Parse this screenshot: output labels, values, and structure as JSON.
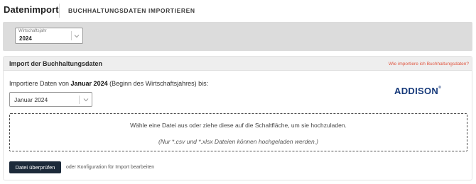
{
  "header": {
    "app_title": "Datenimport",
    "page_title": "BUCHHALTUNGSDATEN IMPORTIEREN"
  },
  "filter": {
    "fiscal_year_label": "Wirtschaftsjahr",
    "fiscal_year_value": "2024"
  },
  "card": {
    "title": "Import der Buchhaltungsdaten",
    "help_link": "Wie importiere ich Buchhaltungsdaten?",
    "import_prefix": "Importiere Daten von ",
    "import_month": "Januar 2024",
    "import_suffix": " (Beginn des Wirtschaftsjahres) bis:",
    "month_select_value": "Januar 2024",
    "brand_logo": "ADDISON",
    "brand_mark": "®",
    "dropzone_text": "Wähle eine Datei aus oder ziehe diese auf die Schaltfläche, um sie hochzuladen.",
    "dropzone_hint": "(Nur *.csv und *.xlsx Dateien können hochgeladen werden.)",
    "check_button": "Datei überprüfen",
    "config_link": "oder Konfiguration für Import bearbeiten"
  },
  "colors": {
    "accent_link": "#e0543e",
    "primary_button": "#1c2a3a",
    "brand": "#173a7a"
  },
  "icons": [
    "chevron-down-icon"
  ]
}
